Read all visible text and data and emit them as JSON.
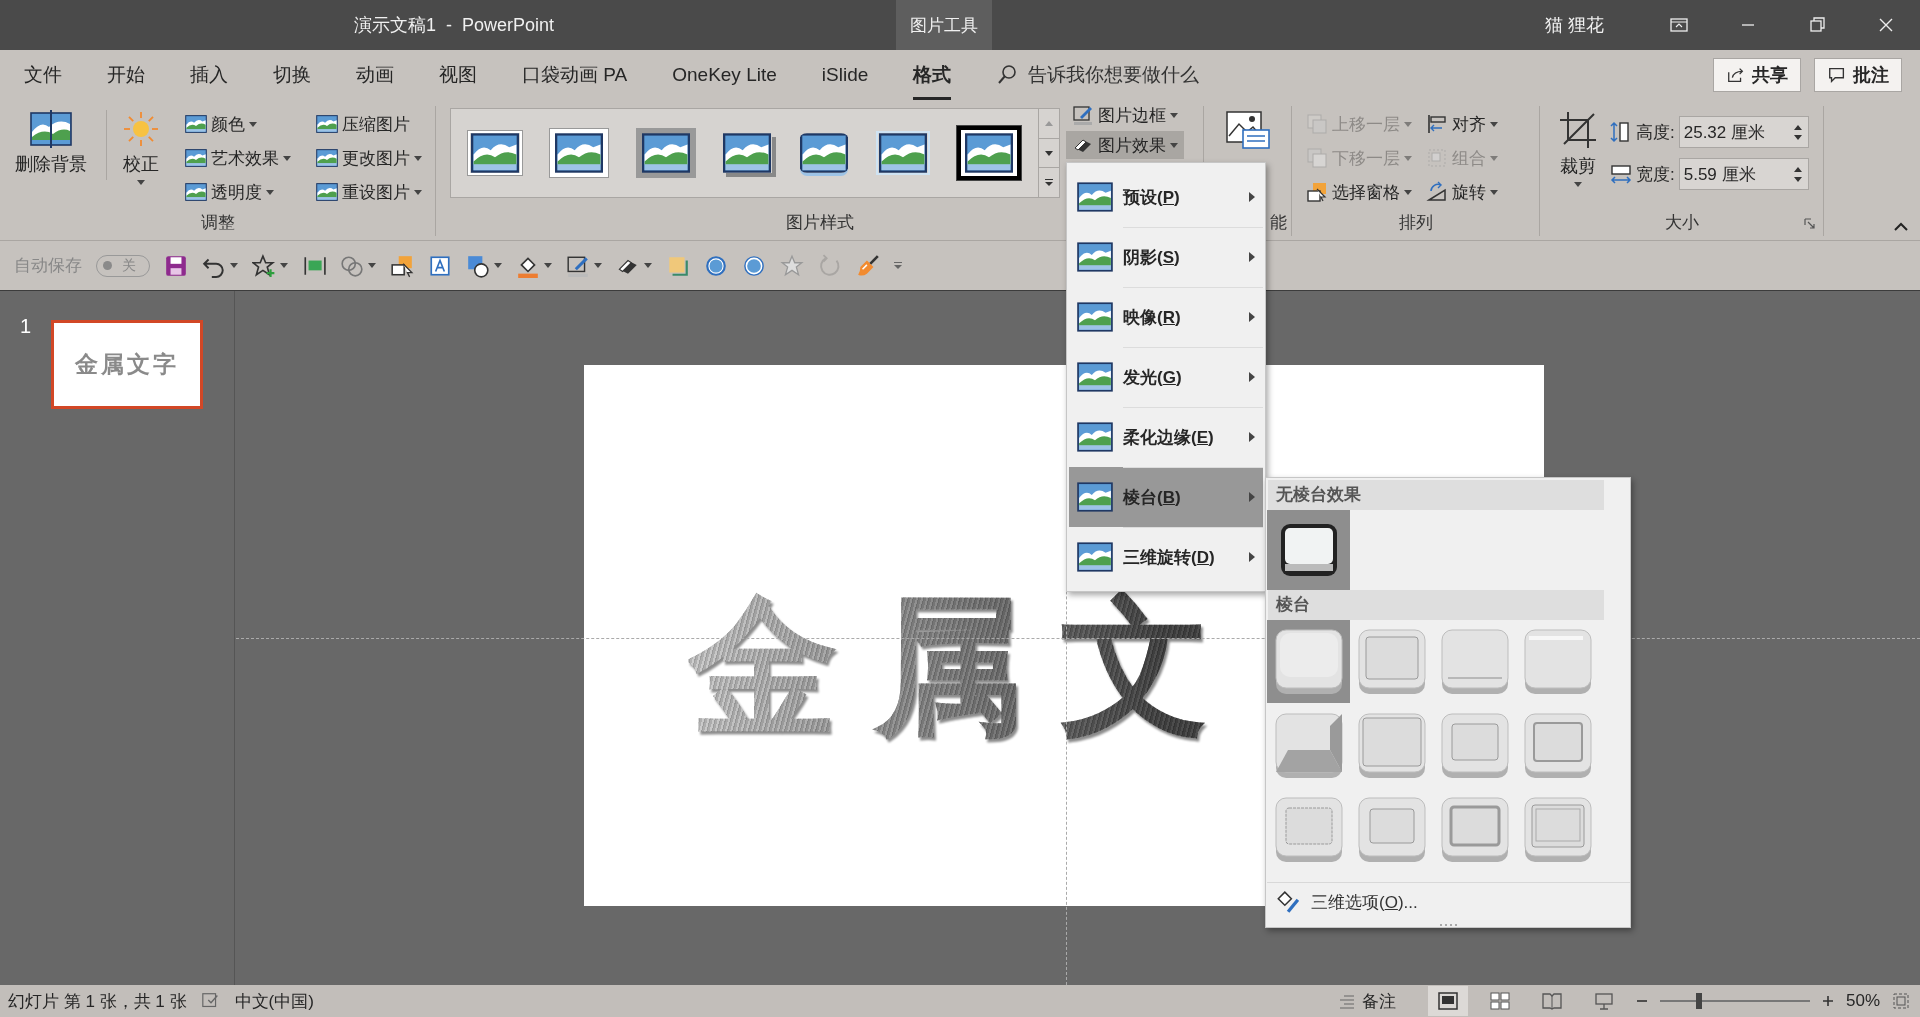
{
  "window": {
    "title": "演示文稿1  -  PowerPoint",
    "context_tab": "图片工具",
    "user": "猫 狸花"
  },
  "tabs": [
    {
      "label": "文件",
      "selected": false
    },
    {
      "label": "开始",
      "selected": false
    },
    {
      "label": "插入",
      "selected": false
    },
    {
      "label": "切换",
      "selected": false
    },
    {
      "label": "动画",
      "selected": false
    },
    {
      "label": "视图",
      "selected": false
    },
    {
      "label": "口袋动画 PA",
      "selected": false
    },
    {
      "label": "OneKey Lite",
      "selected": false
    },
    {
      "label": "iSlide",
      "selected": false
    },
    {
      "label": "格式",
      "selected": true
    }
  ],
  "tell_me": {
    "placeholder": "告诉我你想要做什么"
  },
  "share_button": "共享",
  "comments_button": "批注",
  "ribbon": {
    "adjust": {
      "label": "调整",
      "remove_background": "删除背景",
      "corrections": "校正",
      "commands": [
        {
          "label": "颜色",
          "has_menu": true
        },
        {
          "label": "艺术效果",
          "has_menu": true
        },
        {
          "label": "透明度",
          "has_menu": true
        },
        {
          "label": "压缩图片",
          "has_menu": false
        },
        {
          "label": "更改图片",
          "has_menu": true
        },
        {
          "label": "重设图片",
          "has_menu": true
        }
      ]
    },
    "picture_styles": {
      "label": "图片样式",
      "styles": [
        {
          "kind": "thin-frame"
        },
        {
          "kind": "white-frame"
        },
        {
          "kind": "gray-frame"
        },
        {
          "kind": "drop-shadow"
        },
        {
          "kind": "rounded"
        },
        {
          "kind": "soft-edge"
        },
        {
          "kind": "black-frame"
        }
      ],
      "border": "图片边框",
      "effects": {
        "label": "图片效果",
        "expanded": true
      }
    },
    "accessibility": {
      "label": "能"
    },
    "arrange": {
      "label": "排列",
      "commands": [
        {
          "label": "上移一层",
          "disabled": true
        },
        {
          "label": "下移一层",
          "disabled": true
        },
        {
          "label": "选择窗格",
          "disabled": false
        },
        {
          "label": "对齐",
          "disabled": false
        },
        {
          "label": "组合",
          "disabled": true
        },
        {
          "label": "旋转",
          "disabled": false
        }
      ]
    },
    "size": {
      "label": "大小",
      "crop": "裁剪",
      "height_label": "高度:",
      "height": "25.32 厘米",
      "width_label": "宽度:",
      "width": "5.59 厘米"
    }
  },
  "quick_access": {
    "autosave_label": "自动保存",
    "autosave": {
      "on": false,
      "text": "关"
    }
  },
  "thumbnails": [
    {
      "number": "1",
      "text": "金属文字",
      "selected": true
    }
  ],
  "slide": {
    "text": "金属文"
  },
  "effects_menu": {
    "items": [
      {
        "before": "预设(",
        "key": "P",
        "after": ")",
        "selected": false
      },
      {
        "before": "阴影(",
        "key": "S",
        "after": ")",
        "selected": false
      },
      {
        "before": "映像(",
        "key": "R",
        "after": ")",
        "selected": false
      },
      {
        "before": "发光(",
        "key": "G",
        "after": ")",
        "selected": false
      },
      {
        "before": "柔化边缘(",
        "key": "E",
        "after": ")",
        "selected": false
      },
      {
        "before": "棱台(",
        "key": "B",
        "after": ")",
        "selected": true
      },
      {
        "before": "三维旋转(",
        "key": "D",
        "after": ")",
        "selected": false
      }
    ]
  },
  "bevel_menu": {
    "none_heading": "无棱台效果",
    "none_selected": true,
    "heading": "棱台",
    "presets": [
      {
        "kind": "circle",
        "selected": true
      },
      {
        "kind": "relaxed-inset",
        "selected": false
      },
      {
        "kind": "cross",
        "selected": false
      },
      {
        "kind": "cool-slant",
        "selected": false
      },
      {
        "kind": "angle",
        "selected": false
      },
      {
        "kind": "soft-round",
        "selected": false
      },
      {
        "kind": "convex",
        "selected": false
      },
      {
        "kind": "slope",
        "selected": false
      },
      {
        "kind": "divot",
        "selected": false
      },
      {
        "kind": "riblet",
        "selected": false
      },
      {
        "kind": "hard-edge",
        "selected": false
      },
      {
        "kind": "art-deco",
        "selected": false
      }
    ],
    "options": {
      "before": "三维选项(",
      "key": "O",
      "after": ")..."
    }
  },
  "status_bar": {
    "slide_info": "幻灯片 第 1 张，共 1 张",
    "language": "中文(中国)",
    "notes": "备注",
    "views": [
      {
        "selected": true
      },
      {
        "selected": false
      },
      {
        "selected": false
      },
      {
        "selected": false
      }
    ],
    "zoom": {
      "level": 0.26,
      "text": "50%"
    }
  }
}
